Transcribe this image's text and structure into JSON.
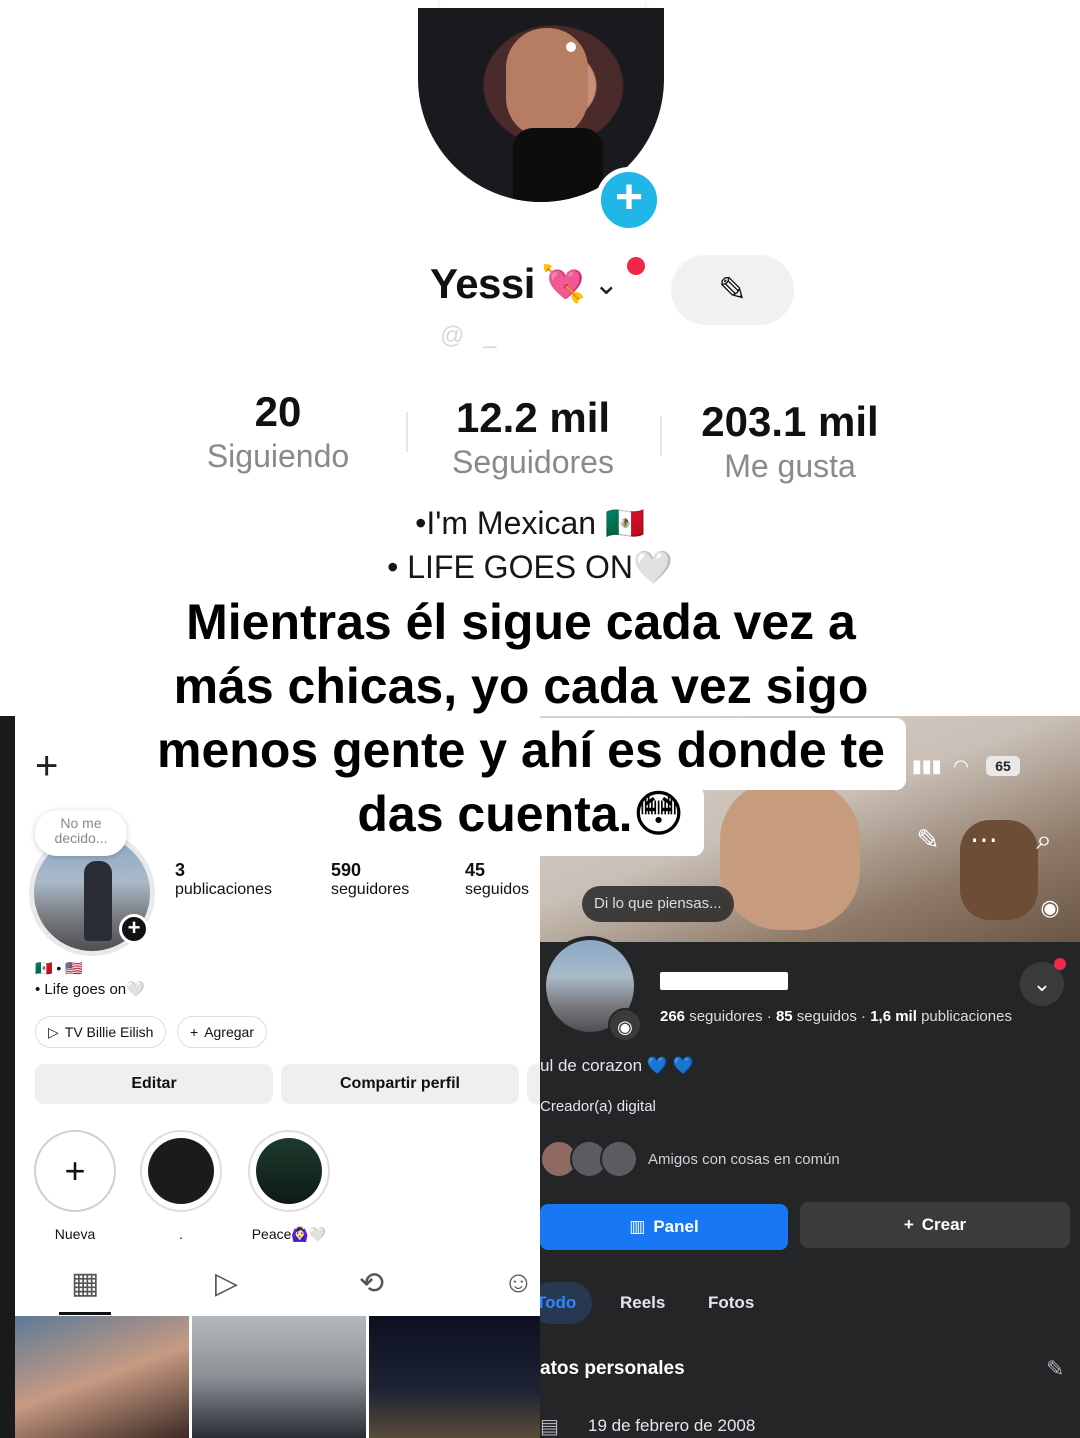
{
  "tiktok": {
    "name": "Yessi",
    "name_emoji": "💘",
    "chevron": "⌄",
    "handle_blurred": "@ _",
    "edit_icon": "✎",
    "add_icon": "+",
    "stats": [
      {
        "value": "20",
        "label": "Siguiendo"
      },
      {
        "value": "12.2 mil",
        "label": "Seguidores"
      },
      {
        "value": "203.1 mil",
        "label": "Me gusta"
      }
    ],
    "bio": [
      "•I'm Mexican 🇲🇽",
      "• LIFE GOES ON🤍"
    ]
  },
  "caption": {
    "lines": [
      "Mientras él sigue cada vez a",
      "más chicas, yo cada vez sigo",
      "menos gente y ahí es donde te",
      "das cuenta.😳"
    ]
  },
  "instagram": {
    "new_icon": "+",
    "note": "No me decido...",
    "stats": [
      {
        "value": "3",
        "label": "publicaciones"
      },
      {
        "value": "590",
        "label": "seguidores"
      },
      {
        "value": "45",
        "label": "seguidos"
      }
    ],
    "flags": "🇲🇽 • 🇺🇸",
    "bio": "• Life goes on🤍",
    "chips": [
      "TV Billie Eilish",
      "Agregar"
    ],
    "buttons": [
      "Editar",
      "Compartir perfil"
    ],
    "highlights": [
      {
        "label": "Nueva"
      },
      {
        "label": "."
      },
      {
        "label": "Peace🙆🏻‍♀️🤍"
      }
    ]
  },
  "facebook": {
    "battery": "65",
    "think_bubble": "Di lo que piensas...",
    "stats": {
      "followers_num": "266",
      "followers_lbl": "seguidores",
      "following_num": "85",
      "following_lbl": "seguidos",
      "posts_num": "1,6 mil",
      "posts_lbl": "publicaciones"
    },
    "bio": "ul de corazon 💙 💙",
    "category": "Creador(a) digital",
    "friends_label": "Amigos con cosas en común",
    "panel_btn": "Panel",
    "create_btn": "Crear",
    "tabs": [
      "Todo",
      "Reels",
      "Fotos"
    ],
    "section": "atos personales",
    "birthday": "19 de febrero de 2008"
  }
}
